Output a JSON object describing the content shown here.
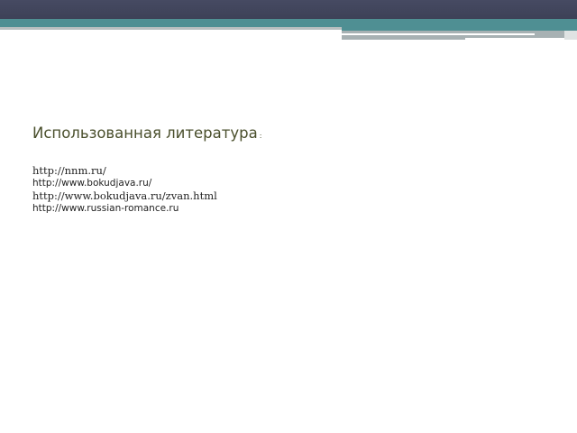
{
  "slide": {
    "title": "Использованная литература",
    "title_suffix": ":"
  },
  "sources": [
    "http://nnm.ru/",
    "http://www.bokudjava.ru/",
    "http://www.bokudjava.ru/zvan.html",
    "http://www.russian-romance.ru"
  ],
  "colors": {
    "header_dark": "#464a62",
    "header_teal": "#4f8f93",
    "title_text": "#4a4f2c"
  }
}
